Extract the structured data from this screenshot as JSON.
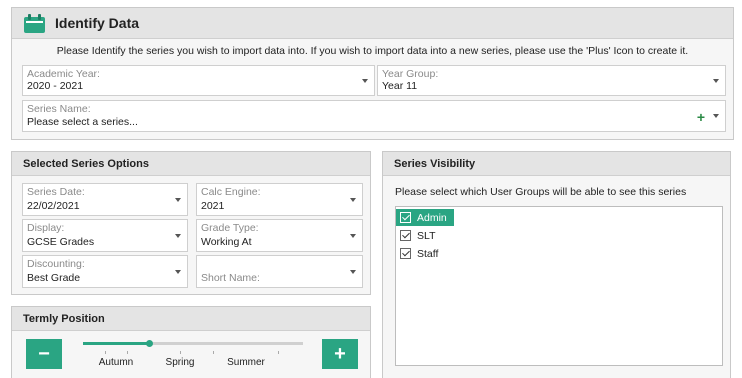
{
  "identify": {
    "title": "Identify Data",
    "instruction": "Please Identify the series you wish to import data into. If you wish to import data into a new series, please use the 'Plus' Icon to create it.",
    "academic_year": {
      "label": "Academic Year:",
      "value": "2020 - 2021"
    },
    "year_group": {
      "label": "Year Group:",
      "value": "Year 11"
    },
    "series_name": {
      "label": "Series Name:",
      "value": "Please select a series..."
    },
    "add_symbol": "+"
  },
  "options": {
    "title": "Selected Series Options",
    "series_date": {
      "label": "Series Date:",
      "value": "22/02/2021"
    },
    "calc_engine": {
      "label": "Calc Engine:",
      "value": "2021"
    },
    "display": {
      "label": "Display:",
      "value": "GCSE Grades"
    },
    "grade_type": {
      "label": "Grade Type:",
      "value": "Working At"
    },
    "discounting": {
      "label": "Discounting:",
      "value": "Best Grade"
    },
    "short_name": {
      "label": "Short Name:",
      "value": ""
    }
  },
  "termly": {
    "title": "Termly Position",
    "minus_symbol": "−",
    "plus_symbol": "+",
    "terms": [
      "Autumn",
      "Spring",
      "Summer"
    ],
    "slider_fraction": 0.3
  },
  "visibility": {
    "title": "Series Visibility",
    "instruction": "Please select which User Groups will be able to see this series",
    "groups": [
      {
        "label": "Admin",
        "checked": true,
        "selected": true
      },
      {
        "label": "SLT",
        "checked": true,
        "selected": false
      },
      {
        "label": "Staff",
        "checked": true,
        "selected": false
      }
    ]
  },
  "colors": {
    "accent": "#2aa583",
    "plus_green": "#2a8a45"
  },
  "icons": {
    "header": "calendar-icon",
    "dropdown": "caret-down-icon",
    "check": "check-icon"
  }
}
